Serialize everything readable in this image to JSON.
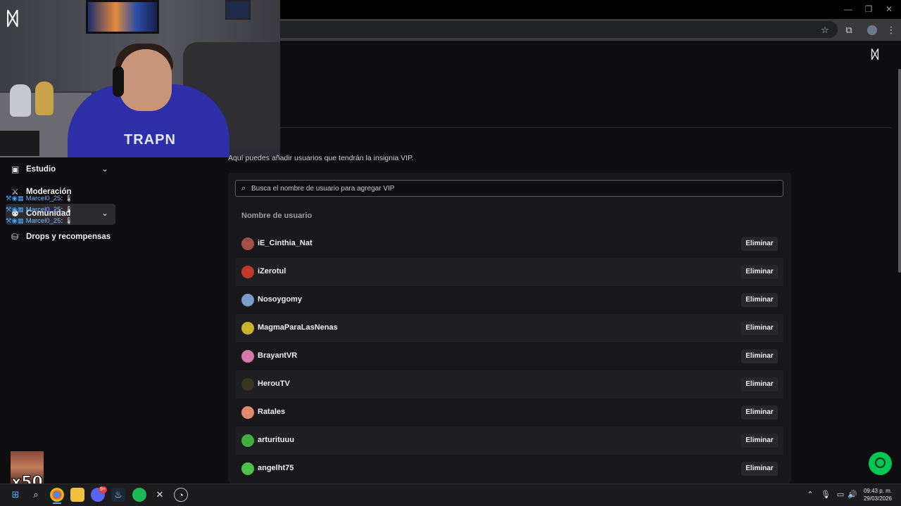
{
  "window": {
    "minimize_glyph": "—",
    "restore_glyph": "❐",
    "close_glyph": "✕"
  },
  "toolbar_icons": [
    "star-icon",
    "extensions-icon",
    "profile-icon",
    "menu-icon"
  ],
  "webcam": {
    "hoodie_text": "TRAPN"
  },
  "sidebar": {
    "items": [
      {
        "label": "Estudio",
        "icon": "studio-icon",
        "has_chevron": true
      },
      {
        "label": "Moderación",
        "icon": "moderation-icon",
        "has_chevron": false
      },
      {
        "label": "Comunidad",
        "icon": "community-icon",
        "has_chevron": true
      },
      {
        "label": "Drops y recompensas",
        "icon": "drops-icon",
        "has_chevron": false
      }
    ]
  },
  "chat_overlay": [
    {
      "user": "Marcel0_25",
      "text": ": 🌡"
    },
    {
      "user": "Marcel0_25",
      "text": ": 🌡"
    },
    {
      "user": "Marcel0_25",
      "text": ": 🌡"
    }
  ],
  "main": {
    "description": "Aquí puedes añadir usuarios que tendrán la insignia VIP.",
    "search_placeholder": "Busca el nombre de usuario para agregar VIP",
    "column_header": "Nombre de usuario",
    "remove_label": "Eliminar",
    "users": [
      {
        "name": "iE_Cinthia_Nat",
        "avatar_color": "#a0524a"
      },
      {
        "name": "iZerotul",
        "avatar_color": "#c0392b"
      },
      {
        "name": "Nosoygomy",
        "avatar_color": "#7a9cc6"
      },
      {
        "name": "MagmaParaLasNenas",
        "avatar_color": "#c9b430"
      },
      {
        "name": "BrayantVR",
        "avatar_color": "#d77aa8"
      },
      {
        "name": "HerouTV",
        "avatar_color": "#3a3420"
      },
      {
        "name": "Ratales",
        "avatar_color": "#e08a6a"
      },
      {
        "name": "arturituuu",
        "avatar_color": "#3fae3f"
      },
      {
        "name": "angelht75",
        "avatar_color": "#4cbf4c"
      }
    ]
  },
  "overlay": {
    "multiplier": "x50"
  },
  "taskbar": {
    "apps": [
      "windows-icon",
      "search-icon",
      "chrome-icon",
      "file-explorer-icon",
      "discord-icon",
      "steam-icon",
      "spotify-icon",
      "x-icon",
      "obs-icon"
    ],
    "discord_badge": "9+",
    "time": "09:43 p. m.",
    "date": "29/03/2026"
  },
  "colors": {
    "accent_green": "#00c853",
    "panel_bg": "#18181b",
    "page_bg": "#0e0e10"
  }
}
